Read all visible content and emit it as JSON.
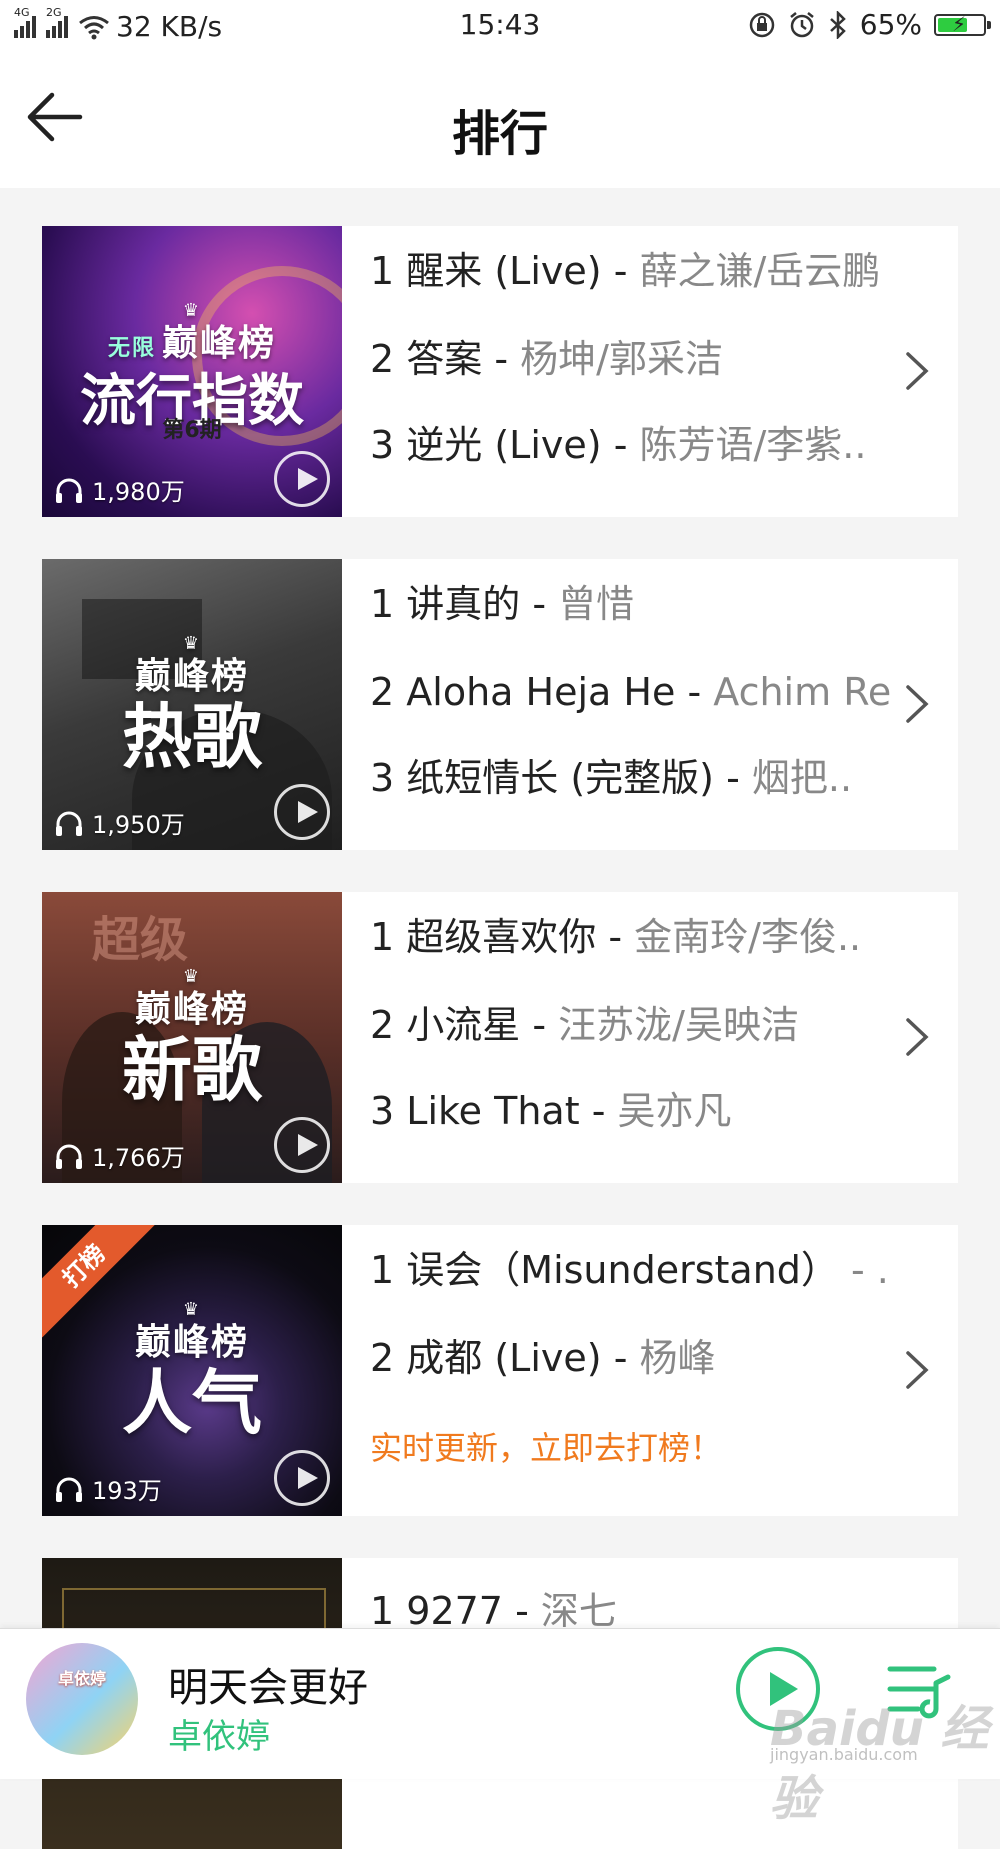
{
  "status_bar": {
    "network_1": "4G",
    "network_2": "2G",
    "speed": "32 KB/s",
    "time": "15:43",
    "battery": "65%",
    "battery_level": 0.65
  },
  "header": {
    "title": "排行"
  },
  "charts": [
    {
      "cover_logo": "巅峰榜",
      "cover_title": "流行指数",
      "cover_prefix": "无限",
      "cover_sub": "第6期",
      "play_count": "1,980万",
      "tracks": [
        {
          "num": "1",
          "song": "醒来 (Live)",
          "sep": " - ",
          "artist": "薛之谦/岳云鹏"
        },
        {
          "num": "2",
          "song": "答案",
          "sep": " - ",
          "artist": "杨坤/郭采洁"
        },
        {
          "num": "3",
          "song": "逆光 (Live)",
          "sep": " - ",
          "artist": "陈芳语/李紫.."
        }
      ]
    },
    {
      "cover_logo": "巅峰榜",
      "cover_title": "热歌",
      "play_count": "1,950万",
      "tracks": [
        {
          "num": "1",
          "song": "讲真的",
          "sep": " - ",
          "artist": "曾惜"
        },
        {
          "num": "2",
          "song": "Aloha Heja He",
          "sep": " - ",
          "artist": "Achim Re.."
        },
        {
          "num": "3",
          "song": "纸短情长 (完整版)",
          "sep": " - ",
          "artist": "烟把.."
        }
      ]
    },
    {
      "cover_logo": "巅峰榜",
      "cover_title": "新歌",
      "cover_bg_text": "超级",
      "play_count": "1,766万",
      "tracks": [
        {
          "num": "1",
          "song": "超级喜欢你",
          "sep": " - ",
          "artist": "金南玲/李俊.."
        },
        {
          "num": "2",
          "song": "小流星",
          "sep": " - ",
          "artist": "汪苏泷/吴映洁"
        },
        {
          "num": "3",
          "song": "Like That",
          "sep": " - ",
          "artist": "吴亦凡"
        }
      ]
    },
    {
      "cover_logo": "巅峰榜",
      "cover_title": "人气",
      "cover_tag": "打榜",
      "play_count": "193万",
      "tracks": [
        {
          "num": "1",
          "song": "误会（Misunderstand）",
          "sep": " - ..",
          "artist": ""
        },
        {
          "num": "2",
          "song": "成都 (Live)",
          "sep": " - ",
          "artist": "杨峰"
        }
      ],
      "promo": "实时更新，立即去打榜！"
    },
    {
      "tracks": [
        {
          "num": "1",
          "song": "9277",
          "sep": " - ",
          "artist": "深七"
        }
      ]
    }
  ],
  "player": {
    "song": "明天会更好",
    "artist": "卓依婷",
    "art_text": "卓依婷"
  },
  "watermark": {
    "logo": "Baidu 经验",
    "url": "jingyan.baidu.com"
  },
  "colors": {
    "accent_green": "#31c27c",
    "promo_orange": "#f07a1e",
    "tag_red": "#e35a2c"
  },
  "icons": [
    "back-arrow-icon",
    "headphones-icon",
    "play-icon",
    "chevron-right-icon",
    "playlist-icon",
    "alarm-icon",
    "bluetooth-icon",
    "lock-rotation-icon",
    "wifi-icon",
    "battery-icon"
  ]
}
